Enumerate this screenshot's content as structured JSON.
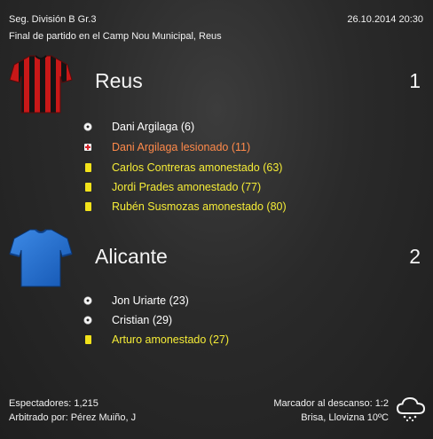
{
  "header": {
    "competition": "Seg. División B Gr.3",
    "datetime": "26.10.2014 20:30",
    "subtitle": "Final de partido en el Camp Nou Municipal, Reus"
  },
  "home": {
    "name": "Reus",
    "score": "1",
    "shirt": "red-black-striped-shirt-icon",
    "colors": {
      "primary": "#d81e1e",
      "secondary": "#111111"
    },
    "events": [
      {
        "icon": "ball-icon",
        "text": "Dani Argilaga (6)",
        "color": "#ffffff"
      },
      {
        "icon": "injury-icon",
        "text": "Dani Argilaga lesionado (11)",
        "color": "#ff8a4a"
      },
      {
        "icon": "yellow-card-icon",
        "text": "Carlos Contreras amonestado (63)",
        "color": "#f5ec37"
      },
      {
        "icon": "yellow-card-icon",
        "text": "Jordi Prades amonestado (77)",
        "color": "#f5ec37"
      },
      {
        "icon": "yellow-card-icon",
        "text": "Rubén Susmozas amonestado (80)",
        "color": "#f5ec37"
      }
    ]
  },
  "away": {
    "name": "Alicante",
    "score": "2",
    "shirt": "blue-shirt-icon",
    "colors": {
      "primary": "#1f6fd1"
    },
    "events": [
      {
        "icon": "ball-icon",
        "text": "Jon Uriarte (23)",
        "color": "#ffffff"
      },
      {
        "icon": "ball-icon",
        "text": "Cristian (29)",
        "color": "#ffffff"
      },
      {
        "icon": "yellow-card-icon",
        "text": "Arturo amonestado (27)",
        "color": "#f5ec37"
      }
    ]
  },
  "footer": {
    "attendance": "Espectadores: 1,215",
    "referee": "Arbitrado por: Pérez Muiño, J",
    "halftime": "Marcador al descanso: 1:2",
    "weather": "Brisa, Llovizna 10ºC",
    "weather_icon": "drizzle-cloud-icon"
  }
}
